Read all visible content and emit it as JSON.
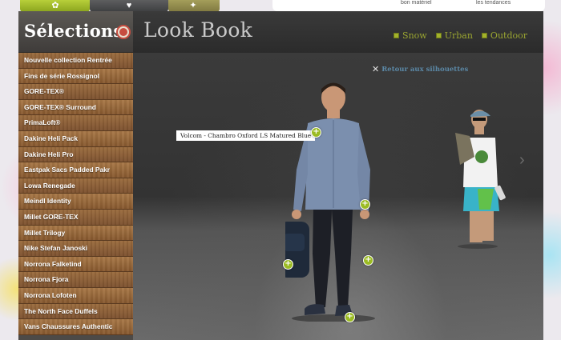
{
  "top_nav": {
    "right_links": [
      "bon matériel",
      "les tendances"
    ]
  },
  "sidebar": {
    "title": "Sélections",
    "items": [
      "Nouvelle collection Rentrée",
      "Fins de série Rossignol",
      "GORE-TEX®",
      "GORE-TEX® Surround",
      "PrimaLoft®",
      "Dakine Heli Pack",
      "Dakine Heli Pro",
      "Eastpak Sacs Padded Pakr",
      "Lowa Renegade",
      "Meindl Identity",
      "Millet GORE-TEX",
      "Millet Trilogy",
      "Nike Stefan Janoski",
      "Norrona Falketind",
      "Norrona Fjora",
      "Norrona Lofoten",
      "The North Face Duffels",
      "Vans Chaussures Authentic"
    ]
  },
  "main": {
    "title": "Look Book",
    "filters": [
      "Snow",
      "Urban",
      "Outdoor"
    ],
    "back_link": "Retour aux silhouettes",
    "tooltip": "Volcom - Chambro Oxford LS Matured Blue",
    "hotspot_symbol": "+",
    "next_arrow": "›"
  },
  "colors": {
    "accent_green": "#9bbb23",
    "link_blue": "#5b88a6",
    "filter_green": "#9aa531"
  }
}
